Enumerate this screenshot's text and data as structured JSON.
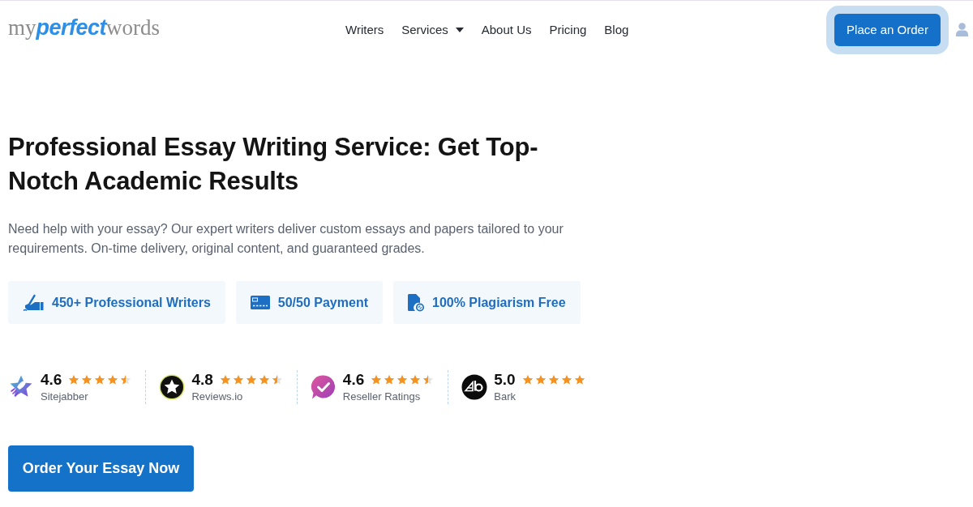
{
  "header": {
    "logo": [
      {
        "text": "my",
        "kind": "plain"
      },
      {
        "text": "perfect",
        "kind": "accent"
      },
      {
        "text": "words",
        "kind": "plain"
      }
    ],
    "nav": [
      {
        "label": "Writers",
        "kind": "link"
      },
      {
        "label": "Services",
        "kind": "dropdown"
      },
      {
        "label": "About Us",
        "kind": "link"
      },
      {
        "label": "Pricing",
        "kind": "link"
      },
      {
        "label": "Blog",
        "kind": "link"
      }
    ],
    "order_button": "Place an Order"
  },
  "hero": {
    "title": "Professional Essay Writing Service: Get Top-Notch Academic Results",
    "description": "Need help with your essay? Our expert writers deliver custom essays and papers tailored to your requirements. On-time delivery, original content, and guaranteed grades.",
    "features": [
      {
        "label": "450+ Professional Writers",
        "kind": "writer"
      },
      {
        "label": "50/50 Payment",
        "kind": "card"
      },
      {
        "label": "100% Plagiarism Free",
        "kind": "document"
      }
    ],
    "ratings": [
      {
        "score": "4.6",
        "stars": 4.5,
        "source": "Sitejabber",
        "kind": "rocket"
      },
      {
        "score": "4.8",
        "stars": 4.5,
        "source": "Reviews.io",
        "kind": "star"
      },
      {
        "score": "4.6",
        "stars": 4.5,
        "source": "Reseller Ratings",
        "kind": "check"
      },
      {
        "score": "5.0",
        "stars": 5,
        "source": "Bark",
        "kind": "monogram"
      }
    ],
    "cta": "Order Your Essay Now"
  }
}
